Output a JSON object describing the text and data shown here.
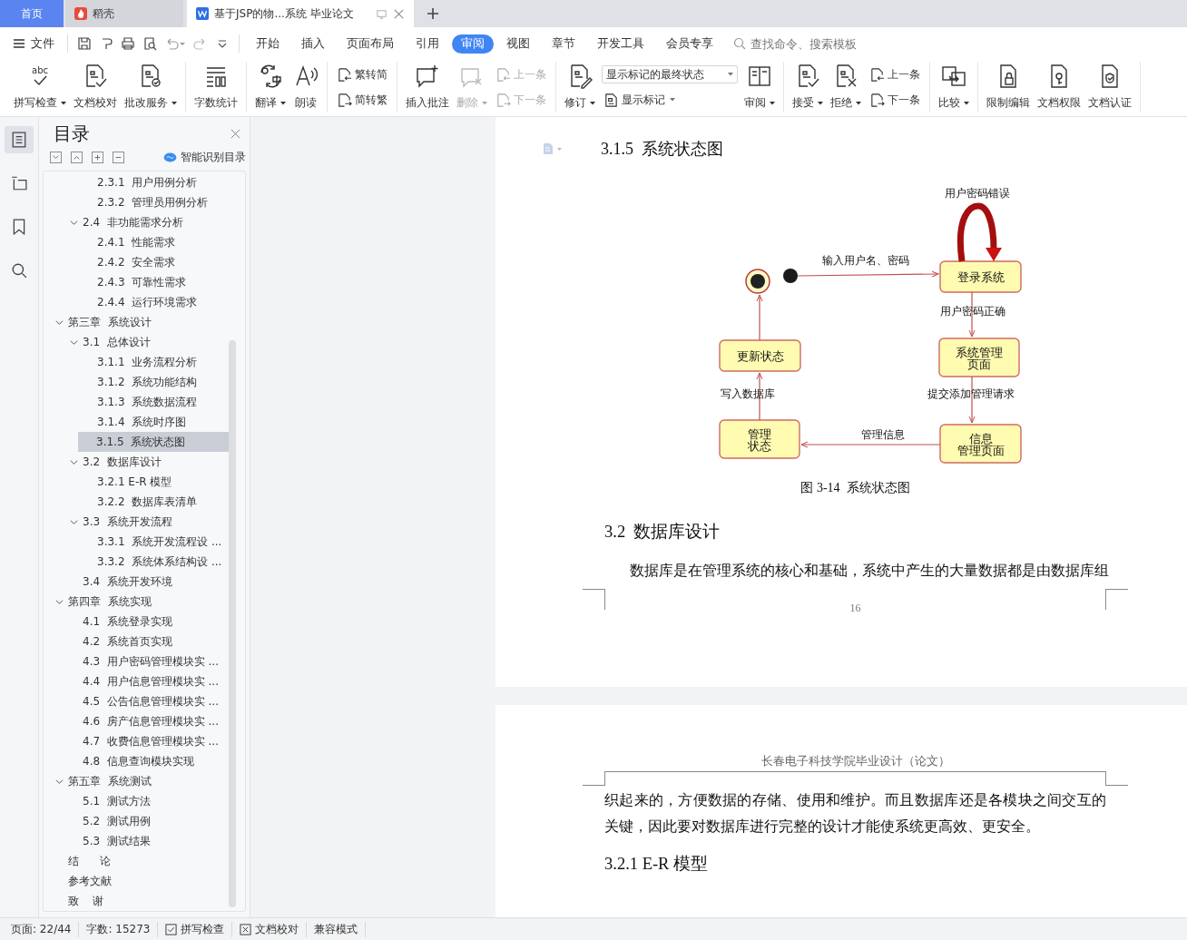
{
  "tabs": [
    {
      "kind": "home",
      "label": "首页",
      "selected": false
    },
    {
      "kind": "app",
      "label": "稻壳",
      "selected": false
    },
    {
      "kind": "doc",
      "label": "基于JSP的物...系统 毕业论文",
      "selected": true
    }
  ],
  "menu": {
    "file": "文件",
    "tabs": [
      {
        "label": "开始",
        "selected": false
      },
      {
        "label": "插入",
        "selected": false
      },
      {
        "label": "页面布局",
        "selected": false
      },
      {
        "label": "引用",
        "selected": false
      },
      {
        "label": "审阅",
        "selected": true
      },
      {
        "label": "视图",
        "selected": false
      },
      {
        "label": "章节",
        "selected": false
      },
      {
        "label": "开发工具",
        "selected": false
      },
      {
        "label": "会员专享",
        "selected": false
      }
    ],
    "search": {
      "placeholder": "查找命令、搜索模板"
    }
  },
  "ribbon": [
    {
      "tools": [
        {
          "kind": "large",
          "label": "拼写检查",
          "glyph": "abc",
          "dropdown": true,
          "disabled": false
        },
        {
          "kind": "large",
          "label": "文档校对",
          "dropdown": false,
          "disabled": false
        },
        {
          "kind": "large",
          "label": "批改服务",
          "dropdown": true,
          "disabled": false
        }
      ]
    },
    {
      "tools": [
        {
          "kind": "large",
          "label": "字数统计",
          "dropdown": false,
          "disabled": false
        }
      ]
    },
    {
      "tools": [
        {
          "kind": "large",
          "label": "翻译",
          "dropdown": true,
          "disabled": false
        },
        {
          "kind": "large",
          "label": "朗读",
          "dropdown": false,
          "disabled": false
        }
      ]
    },
    {
      "tools": [
        {
          "kind": "stack",
          "items": [
            {
              "label": "繁转简",
              "disabled": false
            },
            {
              "label": "简转繁",
              "disabled": false
            }
          ]
        }
      ]
    },
    {
      "tools": [
        {
          "kind": "large",
          "label": "插入批注",
          "dropdown": false,
          "disabled": false
        },
        {
          "kind": "large",
          "label": "删除",
          "dropdown": true,
          "disabled": true
        },
        {
          "kind": "stack",
          "items": [
            {
              "label": "上一条",
              "disabled": true
            },
            {
              "label": "下一条",
              "disabled": true
            }
          ]
        }
      ]
    },
    {
      "tools": [
        {
          "kind": "large",
          "label": "修订",
          "dropdown": true,
          "disabled": false
        },
        {
          "kind": "select",
          "value": "显示标记的最终状态",
          "items": [
            {
              "label": "显示标记",
              "disabled": false
            }
          ]
        },
        {
          "kind": "large",
          "label": "审阅",
          "dropdown": true,
          "disabled": false
        }
      ]
    },
    {
      "tools": [
        {
          "kind": "large",
          "label": "接受",
          "dropdown": true,
          "disabled": false
        },
        {
          "kind": "large",
          "label": "拒绝",
          "dropdown": true,
          "disabled": false
        },
        {
          "kind": "stack",
          "items": [
            {
              "label": "上一条",
              "disabled": false
            },
            {
              "label": "下一条",
              "disabled": false
            }
          ]
        }
      ]
    },
    {
      "tools": [
        {
          "kind": "large",
          "label": "比较",
          "dropdown": true,
          "disabled": false
        }
      ]
    },
    {
      "tools": [
        {
          "kind": "large",
          "label": "限制编辑",
          "dropdown": false,
          "disabled": false
        },
        {
          "kind": "large",
          "label": "文档权限",
          "dropdown": false,
          "disabled": false
        },
        {
          "kind": "large",
          "label": "文档认证",
          "dropdown": false,
          "disabled": false
        }
      ]
    }
  ],
  "toc": {
    "title": "目录",
    "smart": "智能识别目录",
    "items": [
      {
        "children": [
          {
            "children": [
              {
                "label": "2.3.1  用户用例分析",
                "selected": false
              },
              {
                "label": "2.3.2  管理员用例分析",
                "selected": false
              }
            ]
          },
          {
            "label": "2.4  非功能需求分析",
            "selected": false,
            "expanded": true,
            "children": [
              {
                "label": "2.4.1  性能需求",
                "selected": false
              },
              {
                "label": "2.4.2  安全需求",
                "selected": false
              },
              {
                "label": "2.4.3  可靠性需求",
                "selected": false
              },
              {
                "label": "2.4.4  运行环境需求",
                "selected": false
              }
            ]
          }
        ]
      },
      {
        "label": "第三章  系统设计",
        "selected": false,
        "expanded": true,
        "children": [
          {
            "label": "3.1  总体设计",
            "selected": false,
            "expanded": true,
            "children": [
              {
                "label": "3.1.1  业务流程分析",
                "selected": false
              },
              {
                "label": "3.1.2  系统功能结构",
                "selected": false
              },
              {
                "label": "3.1.3  系统数据流程",
                "selected": false
              },
              {
                "label": "3.1.4  系统时序图",
                "selected": false
              },
              {
                "label": "3.1.5  系统状态图",
                "selected": true
              }
            ]
          },
          {
            "label": "3.2  数据库设计",
            "selected": false,
            "expanded": true,
            "children": [
              {
                "label": "3.2.1 E-R 模型",
                "selected": false
              },
              {
                "label": "3.2.2  数据库表清单",
                "selected": false
              }
            ]
          },
          {
            "label": "3.3  系统开发流程",
            "selected": false,
            "expanded": true,
            "children": [
              {
                "label": "3.3.1  系统开发流程设 ...",
                "selected": false
              },
              {
                "label": "3.3.2  系统体系结构设 ...",
                "selected": false
              }
            ]
          },
          {
            "label": "3.4  系统开发环境",
            "selected": false
          }
        ]
      },
      {
        "label": "第四章  系统实现",
        "selected": false,
        "expanded": true,
        "children": [
          {
            "label": "4.1  系统登录实现",
            "selected": false
          },
          {
            "label": "4.2  系统首页实现",
            "selected": false
          },
          {
            "label": "4.3  用户密码管理模块实 ...",
            "selected": false
          },
          {
            "label": "4.4  用户信息管理模块实 ...",
            "selected": false
          },
          {
            "label": "4.5  公告信息管理模块实 ...",
            "selected": false
          },
          {
            "label": "4.6  房产信息管理模块实 ...",
            "selected": false
          },
          {
            "label": "4.7  收费信息管理模块实 ...",
            "selected": false
          },
          {
            "label": "4.8  信息查询模块实现",
            "selected": false
          }
        ]
      },
      {
        "label": "第五章  系统测试",
        "selected": false,
        "expanded": true,
        "children": [
          {
            "label": "5.1  测试方法",
            "selected": false
          },
          {
            "label": "5.2  测试用例",
            "selected": false
          },
          {
            "label": "5.3  测试结果",
            "selected": false
          }
        ]
      },
      {
        "label": "结      论",
        "selected": false
      },
      {
        "label": "参考文献",
        "selected": false
      },
      {
        "label": "致    谢",
        "selected": false
      }
    ]
  },
  "document": {
    "heading": "3.1.5  系统状态图",
    "diagram": {
      "nodes": [
        {
          "kind": "final"
        },
        {
          "kind": "initial"
        },
        {
          "kind": "state",
          "lines": [
            "登录系统"
          ]
        },
        {
          "kind": "state",
          "lines": [
            "更新状态"
          ]
        },
        {
          "kind": "state",
          "lines": [
            "系统管理",
            "页面"
          ]
        },
        {
          "kind": "state",
          "lines": [
            "管理",
            "状态"
          ]
        },
        {
          "kind": "state",
          "lines": [
            "信息",
            "管理页面"
          ]
        }
      ],
      "transitions": [
        {
          "kind": "self",
          "label": "用户密码错误"
        },
        {
          "kind": "line",
          "label": "输入用户名、密码"
        },
        {
          "kind": "line",
          "label": "用户密码正确"
        },
        {
          "kind": "line",
          "label": "提交添加管理请求"
        },
        {
          "kind": "line",
          "label": "管理信息"
        },
        {
          "kind": "line",
          "label": "写入数据库"
        },
        {
          "kind": "line"
        }
      ]
    },
    "caption": "图 3-14  系统状态图",
    "section": "3.2  数据库设计",
    "paragraph": "数据库是在管理系统的核心和基础，系统中产生的大量数据都是由数据库组",
    "page_number": "16",
    "page2_header": "长春电子科技学院毕业设计（论文）",
    "page2_paragraph": "织起来的，方便数据的存储、使用和维护。而且数据库还是各模块之间交互的关键，因此要对数据库进行完整的设计才能使系统更高效、更安全。",
    "page2_section": "3.2.1 E-R 模型"
  },
  "status_bar": [
    {
      "kind": "text",
      "label": "页面: 22/44"
    },
    {
      "kind": "text",
      "label": "字数: 15273"
    },
    {
      "kind": "spell",
      "label": "拼写检查"
    },
    {
      "kind": "proof",
      "label": "文档校对"
    },
    {
      "kind": "text",
      "label": "兼容模式"
    }
  ]
}
